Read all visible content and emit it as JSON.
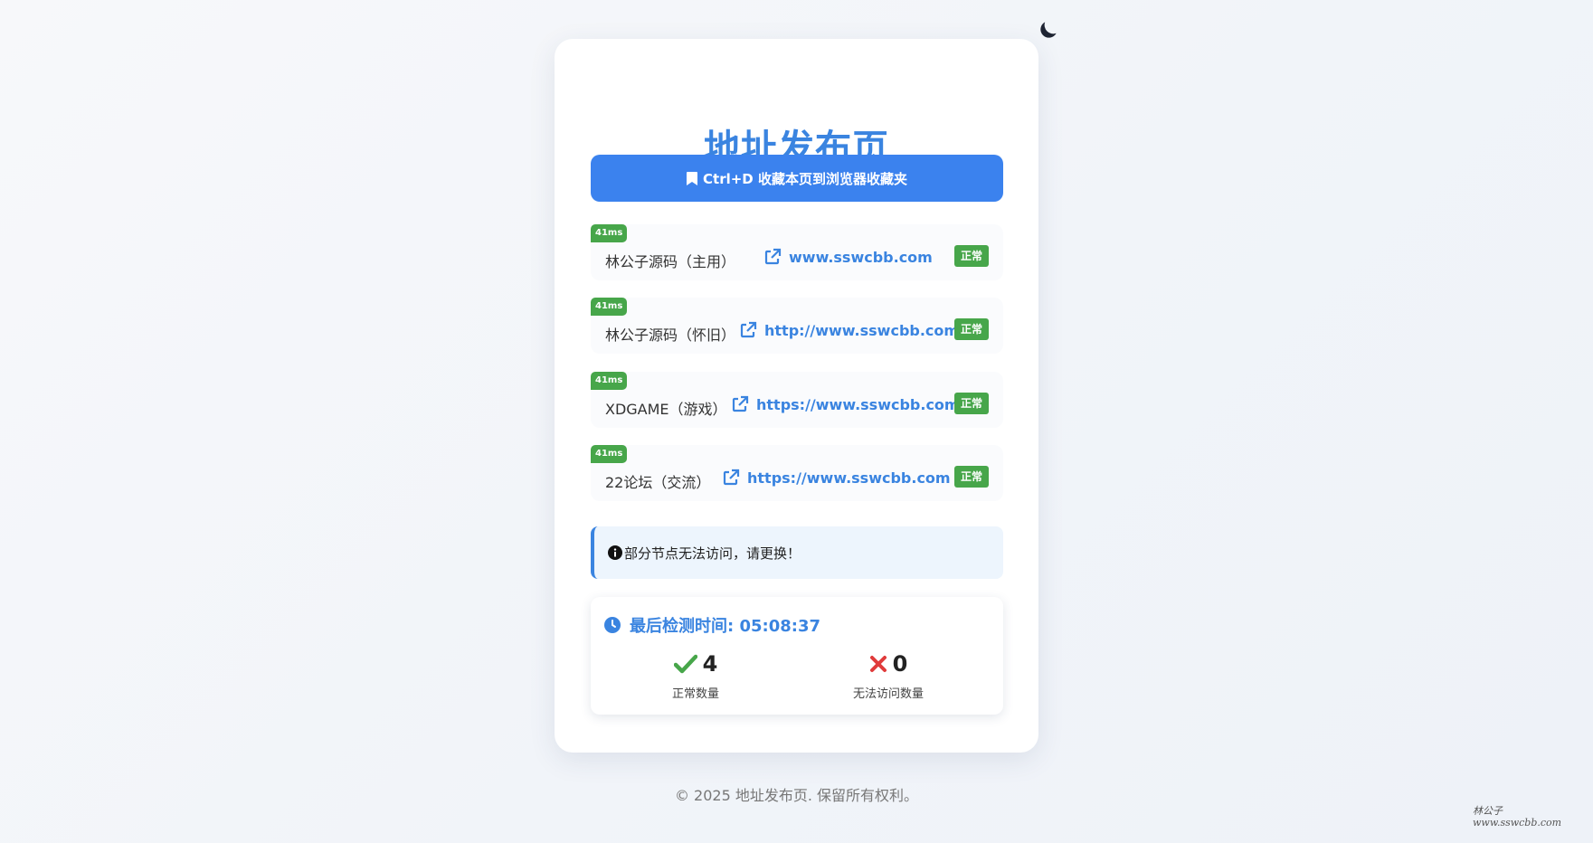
{
  "page": {
    "title": "地址发布页"
  },
  "theme_toggle": {
    "icon": "moon-icon"
  },
  "bookmark_button": {
    "label": "Ctrl+D 收藏本页到浏览器收藏夹",
    "icon": "bookmark-icon"
  },
  "links": [
    {
      "latency": "41ms",
      "name": "林公子源码（主用）",
      "url": "www.sswcbb.com",
      "status": "正常"
    },
    {
      "latency": "41ms",
      "name": "林公子源码（怀旧）",
      "url": "http://www.sswcbb.com",
      "status": "正常"
    },
    {
      "latency": "41ms",
      "name": "XDGAME（游戏）",
      "url": "https://www.sswcbb.com",
      "status": "正常"
    },
    {
      "latency": "41ms",
      "name": "22论坛（交流）",
      "url": "https://www.sswcbb.com",
      "status": "正常"
    }
  ],
  "notice": {
    "text": "部分节点无法访问，请更换！",
    "icon": "info-circle-icon"
  },
  "stats": {
    "last_check_label": "最后检测时间: 05:08:37",
    "ok_count": "4",
    "ok_label": "正常数量",
    "fail_count": "0",
    "fail_label": "无法访问数量"
  },
  "footer": {
    "text": "© 2025 地址发布页. 保留所有权利。"
  },
  "watermark": {
    "line1": "林公子",
    "line2": "www.sswcbb.com"
  },
  "colors": {
    "primary": "#3a84e0",
    "button": "#3b82ee",
    "success": "#47a64a",
    "danger": "#e03b3b"
  }
}
